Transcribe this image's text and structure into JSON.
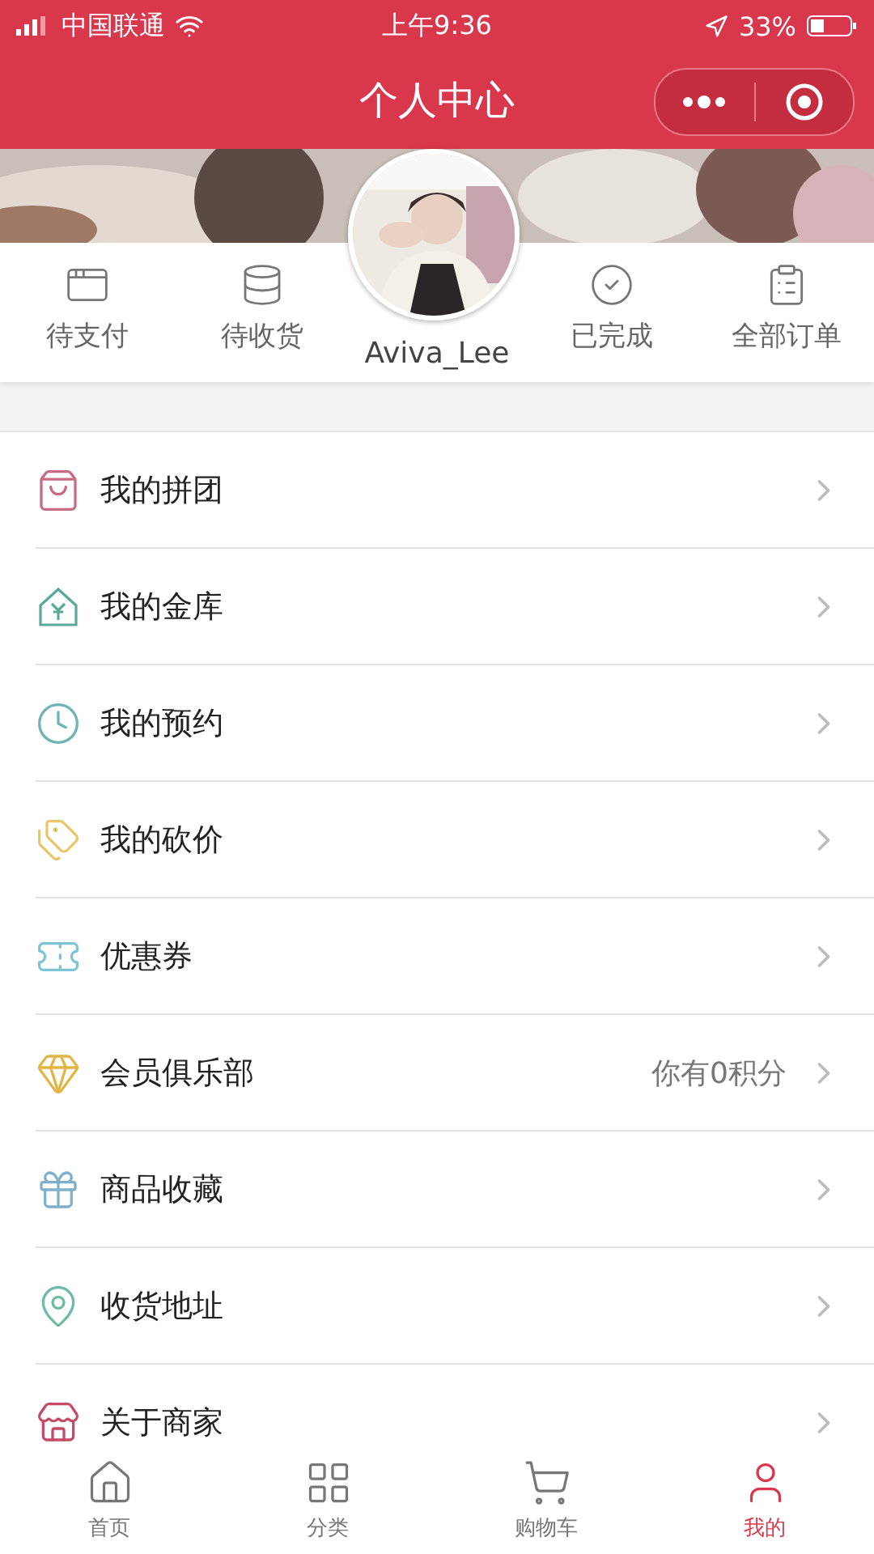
{
  "status_bar": {
    "carrier": "中国联通",
    "time": "上午9:36",
    "battery": "33%"
  },
  "nav": {
    "title": "个人中心"
  },
  "profile": {
    "username": "Aviva_Lee"
  },
  "orders": [
    {
      "label": "待支付"
    },
    {
      "label": "待收货"
    },
    {
      "label": "已完成"
    },
    {
      "label": "全部订单"
    }
  ],
  "menu": [
    {
      "label": "我的拼团",
      "color": "#c96a83"
    },
    {
      "label": "我的金库",
      "color": "#5aa99a"
    },
    {
      "label": "我的预约",
      "color": "#6fb3b3"
    },
    {
      "label": "我的砍价",
      "color": "#e8c66a"
    },
    {
      "label": "优惠券",
      "color": "#7cc4d6"
    },
    {
      "label": "会员俱乐部",
      "value": "你有0积分",
      "color": "#e2b443"
    },
    {
      "label": "商品收藏",
      "color": "#7fb0cc"
    },
    {
      "label": "收货地址",
      "color": "#6dbba6"
    },
    {
      "label": "关于商家",
      "color": "#c44a66"
    }
  ],
  "tabs": [
    {
      "label": "首页",
      "selected": false
    },
    {
      "label": "分类",
      "selected": false
    },
    {
      "label": "购物车",
      "selected": false
    },
    {
      "label": "我的",
      "selected": true
    }
  ]
}
